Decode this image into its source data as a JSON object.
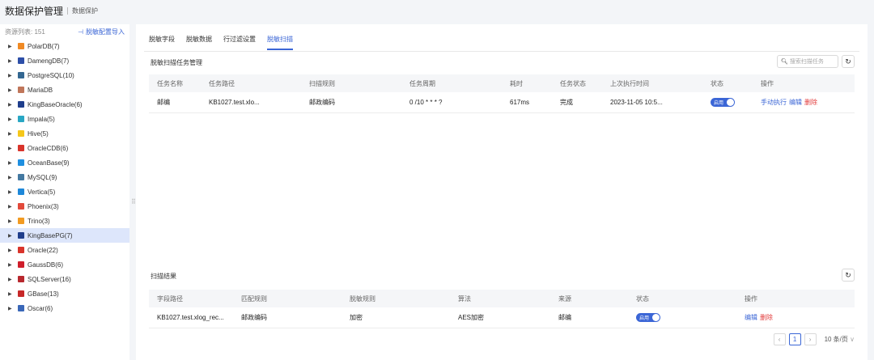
{
  "header": {
    "title": "数据保护管理",
    "crumb": "数据保护"
  },
  "sidebar": {
    "count_label": "资源列表: 151",
    "import_label": "脱敏配置导入",
    "items": [
      {
        "label": "PolarDB(7)",
        "color": "#f08a24",
        "glyph": ""
      },
      {
        "label": "DamengDB(7)",
        "color": "#2d4fa8",
        "glyph": ""
      },
      {
        "label": "PostgreSQL(10)",
        "color": "#336791",
        "glyph": ""
      },
      {
        "label": "MariaDB",
        "color": "#c0765a",
        "glyph": ""
      },
      {
        "label": "KingBaseOracle(6)",
        "color": "#1f3e8c",
        "glyph": ""
      },
      {
        "label": "Impala(5)",
        "color": "#29a7c4",
        "glyph": ""
      },
      {
        "label": "Hive(5)",
        "color": "#f5c71a",
        "glyph": ""
      },
      {
        "label": "OracleCDB(6)",
        "color": "#d9342b",
        "glyph": ""
      },
      {
        "label": "OceanBase(9)",
        "color": "#1f8fe0",
        "glyph": ""
      },
      {
        "label": "MySQL(9)",
        "color": "#4479a1",
        "glyph": ""
      },
      {
        "label": "Vertica(5)",
        "color": "#1e88d9",
        "glyph": ""
      },
      {
        "label": "Phoenix(3)",
        "color": "#e24a3b",
        "glyph": ""
      },
      {
        "label": "Trino(3)",
        "color": "#f29b22",
        "glyph": ""
      },
      {
        "label": "KingBasePG(7)",
        "color": "#1f3e8c",
        "glyph": ""
      },
      {
        "label": "Oracle(22)",
        "color": "#d9342b",
        "glyph": ""
      },
      {
        "label": "GaussDB(6)",
        "color": "#cf1e2b",
        "glyph": ""
      },
      {
        "label": "SQLServer(16)",
        "color": "#b8282e",
        "glyph": ""
      },
      {
        "label": "GBase(13)",
        "color": "#c72828",
        "glyph": ""
      },
      {
        "label": "Oscar(6)",
        "color": "#3a67b8",
        "glyph": ""
      }
    ],
    "selected_index": 13
  },
  "tabs": [
    {
      "label": "脱敏字段",
      "active": false
    },
    {
      "label": "脱敏数据",
      "active": false
    },
    {
      "label": "行过滤设置",
      "active": false
    },
    {
      "label": "脱敏扫描",
      "active": true
    }
  ],
  "task_section": {
    "title": "脱敏扫描任务管理",
    "search_placeholder": "搜索扫描任务",
    "columns": [
      "任务名称",
      "任务路径",
      "扫描规则",
      "任务周期",
      "耗时",
      "任务状态",
      "上次执行时间",
      "状态",
      "操作"
    ],
    "rows": [
      {
        "name": "邮编",
        "path": "KB1027.test.xlo...",
        "rule": "邮政编码",
        "cycle": "0 /10 * * * ?",
        "duration": "617ms",
        "task_status": "完成",
        "last_run": "2023-11-05 10:5...",
        "toggle_label": "启用",
        "actions": [
          "手动执行",
          "编辑",
          "删除"
        ]
      }
    ]
  },
  "result_section": {
    "title": "扫描结果",
    "columns": [
      "字段路径",
      "匹配规则",
      "脱敏规则",
      "算法",
      "来源",
      "状态",
      "操作"
    ],
    "rows": [
      {
        "path": "KB1027.test.xlog_rec...",
        "match_rule": "邮政编码",
        "mask_rule": "加密",
        "algorithm": "AES加密",
        "source": "邮编",
        "toggle_label": "启用",
        "actions": [
          "编辑",
          "删除"
        ]
      }
    ]
  },
  "pagination": {
    "current_page": "1",
    "page_size": "10 条/页"
  }
}
